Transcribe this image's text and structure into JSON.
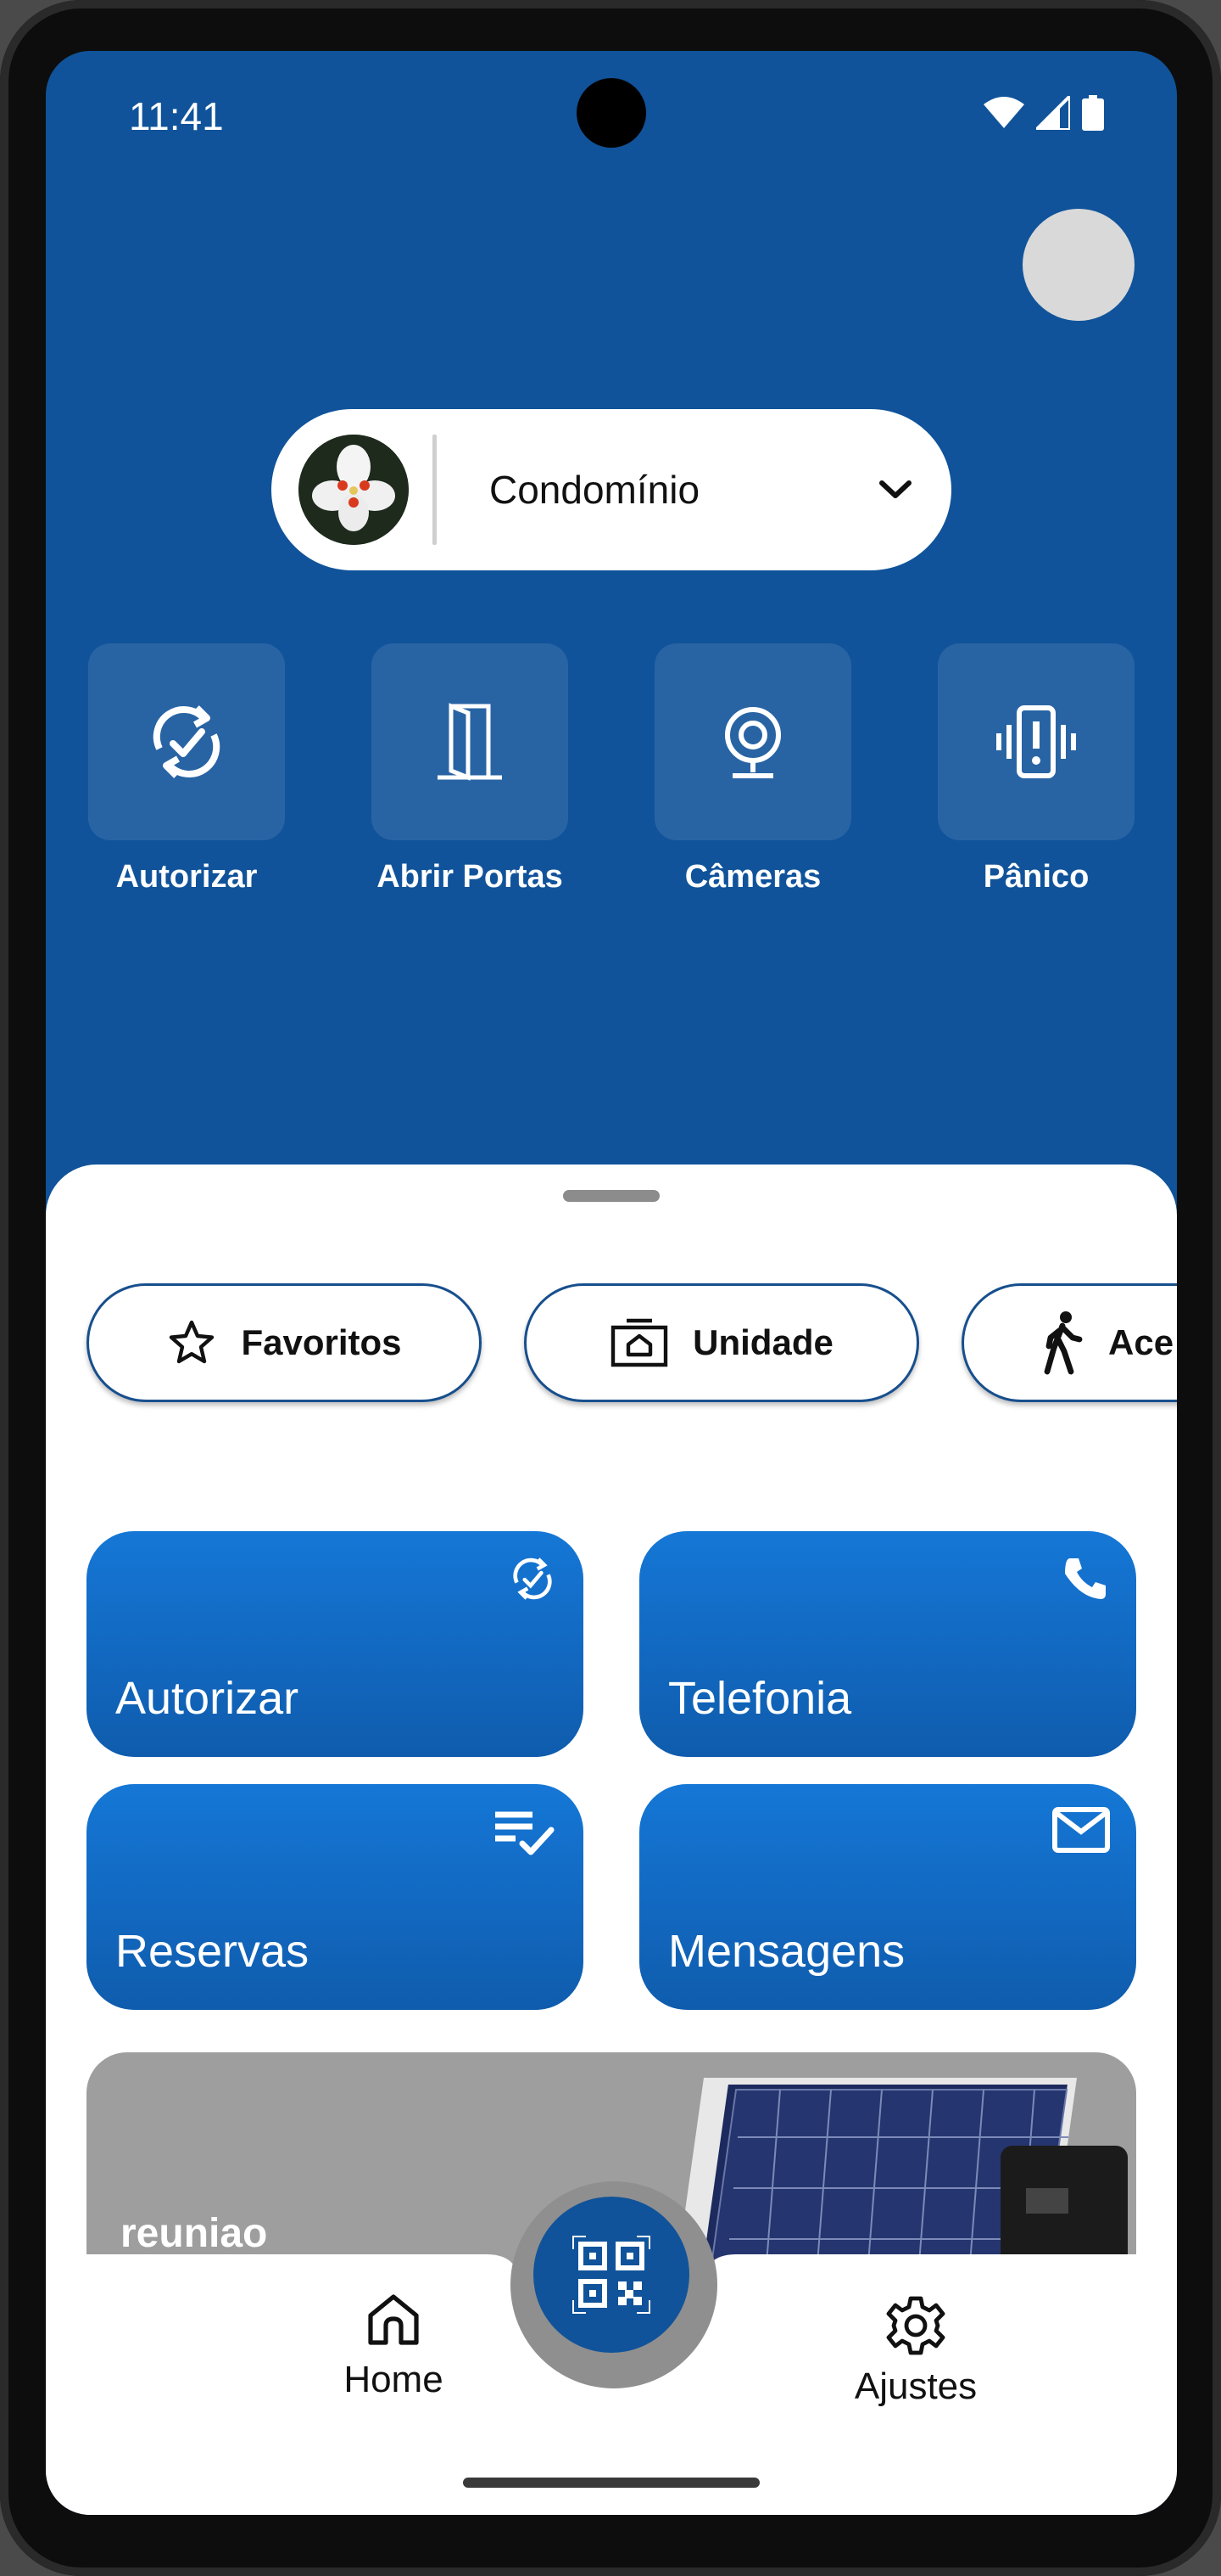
{
  "status_bar": {
    "time": "11:41"
  },
  "condo_selector": {
    "label": "Condomínio"
  },
  "quick_actions": [
    {
      "label": "Autorizar",
      "icon": "sync-check-icon"
    },
    {
      "label": "Abrir Portas",
      "icon": "door-icon"
    },
    {
      "label": "Câmeras",
      "icon": "camera-icon"
    },
    {
      "label": "Pânico",
      "icon": "panic-vibrate-icon"
    }
  ],
  "chips": [
    {
      "label": "Favoritos",
      "icon": "star-icon"
    },
    {
      "label": "Unidade",
      "icon": "home-photo-icon"
    },
    {
      "label": "Ace",
      "icon": "walking-person-icon"
    }
  ],
  "cards": [
    {
      "label": "Autorizar",
      "icon": "sync-check-icon"
    },
    {
      "label": "Telefonia",
      "icon": "phone-icon"
    },
    {
      "label": "Reservas",
      "icon": "checklist-icon"
    },
    {
      "label": "Mensagens",
      "icon": "mail-icon"
    }
  ],
  "banner": {
    "title": "reuniao"
  },
  "nav": {
    "home_label": "Home",
    "settings_label": "Ajustes",
    "fab_icon": "qr-code-icon"
  },
  "colors": {
    "primary": "#10539a",
    "card_top": "#1577d6",
    "card_bottom": "#0f5cad"
  }
}
